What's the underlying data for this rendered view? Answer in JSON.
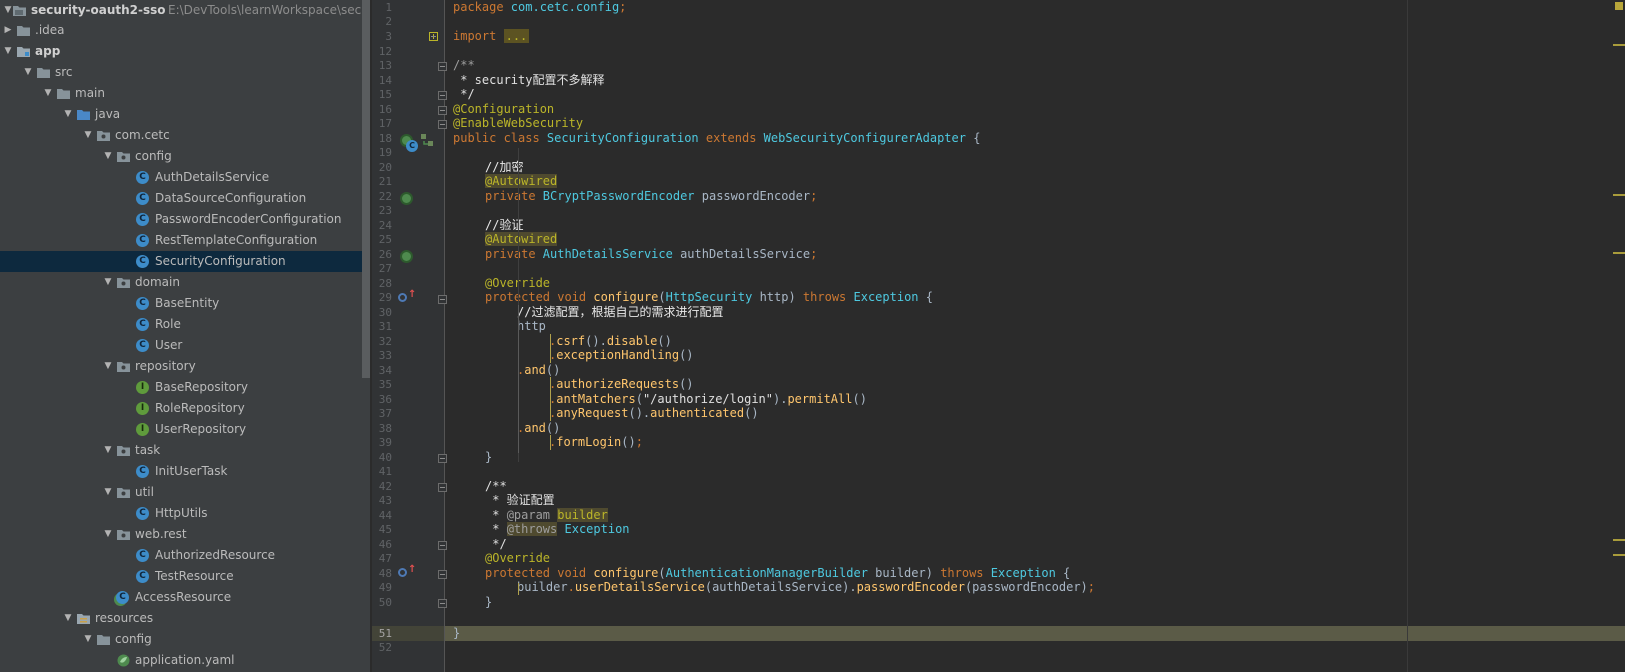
{
  "project_tree": {
    "root": {
      "name": "security-oauth2-sso",
      "path": "E:\\DevTools\\learnWorkspace\\securit"
    },
    "items": [
      {
        "label": ".idea",
        "kind": "folder",
        "arrow": "right"
      },
      {
        "label": "app",
        "kind": "module",
        "arrow": "down",
        "bold": true
      },
      {
        "label": "src",
        "kind": "folder",
        "arrow": "down"
      },
      {
        "label": "main",
        "kind": "folder",
        "arrow": "down"
      },
      {
        "label": "java",
        "kind": "source-folder",
        "arrow": "down"
      },
      {
        "label": "com.cetc",
        "kind": "package",
        "arrow": "down"
      },
      {
        "label": "config",
        "kind": "package",
        "arrow": "down"
      },
      {
        "label": "AuthDetailsService",
        "kind": "class"
      },
      {
        "label": "DataSourceConfiguration",
        "kind": "class"
      },
      {
        "label": "PasswordEncoderConfiguration",
        "kind": "class"
      },
      {
        "label": "RestTemplateConfiguration",
        "kind": "class"
      },
      {
        "label": "SecurityConfiguration",
        "kind": "class",
        "selected": true
      },
      {
        "label": "domain",
        "kind": "package",
        "arrow": "down"
      },
      {
        "label": "BaseEntity",
        "kind": "class"
      },
      {
        "label": "Role",
        "kind": "class"
      },
      {
        "label": "User",
        "kind": "class"
      },
      {
        "label": "repository",
        "kind": "package",
        "arrow": "down"
      },
      {
        "label": "BaseRepository",
        "kind": "interface"
      },
      {
        "label": "RoleRepository",
        "kind": "interface"
      },
      {
        "label": "UserRepository",
        "kind": "interface"
      },
      {
        "label": "task",
        "kind": "package",
        "arrow": "down"
      },
      {
        "label": "InitUserTask",
        "kind": "class"
      },
      {
        "label": "util",
        "kind": "package",
        "arrow": "down"
      },
      {
        "label": "HttpUtils",
        "kind": "class"
      },
      {
        "label": "web.rest",
        "kind": "package",
        "arrow": "down"
      },
      {
        "label": "AuthorizedResource",
        "kind": "class"
      },
      {
        "label": "TestResource",
        "kind": "class"
      },
      {
        "label": "AccessResource",
        "kind": "spring-class"
      },
      {
        "label": "resources",
        "kind": "resources-folder",
        "arrow": "down"
      },
      {
        "label": "config",
        "kind": "folder",
        "arrow": "down"
      },
      {
        "label": "application.yaml",
        "kind": "yaml"
      }
    ]
  },
  "editor": {
    "line_numbers": [
      "1",
      "2",
      "3",
      "12",
      "13",
      "14",
      "15",
      "16",
      "17",
      "18",
      "19",
      "20",
      "21",
      "22",
      "23",
      "24",
      "25",
      "26",
      "27",
      "28",
      "29",
      "30",
      "31",
      "32",
      "33",
      "34",
      "35",
      "36",
      "37",
      "38",
      "39",
      "40",
      "41",
      "42",
      "43",
      "44",
      "45",
      "46",
      "47",
      "48",
      "49",
      "50",
      "51",
      "52"
    ],
    "code": {
      "l1": [
        "package",
        " com.cetc.config",
        ";"
      ],
      "l3_import": "import",
      "l3_fold": "...",
      "l13": "/**",
      "l14": " * security配置不多解释",
      "l15": " */",
      "l16": "@Configuration",
      "l17": "@EnableWebSecurity",
      "l18": [
        "public class ",
        "SecurityConfiguration",
        " extends ",
        "WebSecurityConfigurerAdapter",
        " {"
      ],
      "l20": "//加密",
      "l21": "@Autowired",
      "l22": [
        "private ",
        "BCryptPasswordEncoder",
        " passwordEncoder",
        ";"
      ],
      "l24": "//验证",
      "l25": "@Autowired",
      "l26": [
        "private ",
        "AuthDetailsService",
        " authDetailsService",
        ";"
      ],
      "l28": "@Override",
      "l29": [
        "protected void ",
        "configure",
        "(",
        "HttpSecurity",
        " http) ",
        "throws ",
        "Exception",
        " {"
      ],
      "l30": "//过滤配置，根据自己的需求进行配置",
      "l31": "http",
      "l32": [
        ".",
        "csrf",
        "().",
        "disable",
        "()"
      ],
      "l33": [
        ".",
        "exceptionHandling",
        "()"
      ],
      "l34": [
        ".",
        "and",
        "()"
      ],
      "l35": [
        ".",
        "authorizeRequests",
        "()"
      ],
      "l36": [
        ".",
        "antMatchers",
        "(",
        "\"/authorize/login\"",
        ").",
        "permitAll",
        "()"
      ],
      "l37": [
        ".",
        "anyRequest",
        "().",
        "authenticated",
        "()"
      ],
      "l38": [
        ".",
        "and",
        "()"
      ],
      "l39": [
        ".",
        "formLogin",
        "()",
        ";"
      ],
      "l40": "}",
      "l42": "/**",
      "l43": " * 验证配置",
      "l44": [
        " * ",
        "@param",
        " ",
        "builder"
      ],
      "l45": [
        " * ",
        "@throws",
        " ",
        "Exception"
      ],
      "l46": " */",
      "l47": "@Override",
      "l48": [
        "protected void ",
        "configure",
        "(",
        "AuthenticationManagerBuilder",
        " builder) ",
        "throws ",
        "Exception",
        " {"
      ],
      "l49": [
        "builder",
        ".",
        "userDetailsService",
        "(authDetailsService).",
        "passwordEncoder",
        "(passwordEncoder)",
        ";"
      ],
      "l50": "}",
      "l51": "}"
    }
  },
  "colors": {
    "keyword": "#cc7832",
    "annotation": "#bbb529",
    "type": "#4ec9e0",
    "string": "#6a8759",
    "method": "#ffc66d",
    "selection": "#0d293e"
  }
}
